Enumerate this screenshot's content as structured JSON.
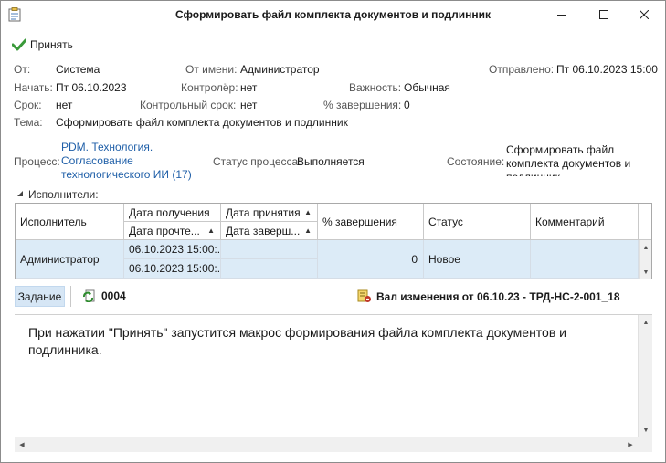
{
  "window": {
    "title": "Сформировать файл комплекта документов и подлинник"
  },
  "toolbar": {
    "accept_label": "Принять"
  },
  "header": {
    "from_label": "От:",
    "from_value": "Система",
    "on_behalf_label": "От имени:",
    "on_behalf_value": "Администратор",
    "sent_label": "Отправлено:",
    "sent_value": "Пт 06.10.2023 15:00",
    "start_label": "Начать:",
    "start_value": "Пт 06.10.2023",
    "controller_label": "Контролёр:",
    "controller_value": "нет",
    "importance_label": "Важность:",
    "importance_value": "Обычная",
    "deadline_label": "Срок:",
    "deadline_value": "нет",
    "control_deadline_label": "Контрольный срок:",
    "control_deadline_value": "нет",
    "completion_label": "% завершения:",
    "completion_value": "0",
    "subject_label": "Тема:",
    "subject_value": "Сформировать файл комплекта документов и подлинник"
  },
  "process": {
    "label": "Процесс:",
    "link_line1": "PDM. Технология.",
    "link_line2": "Согласование",
    "link_line3": "технологического ИИ (17)",
    "status_label": "Статус процесса:",
    "status_value": "Выполняется",
    "state_label": "Состояние:",
    "state_value": "Сформировать файл комплекта документов и подлинник"
  },
  "executors": {
    "section_label": "Исполнители:",
    "columns": {
      "executor": "Исполнитель",
      "received": "Дата получения",
      "accepted": "Дата принятия",
      "read": "Дата прочте...",
      "finished": "Дата заверш...",
      "completion": "% завершения",
      "status": "Статус",
      "comment": "Комментарий"
    },
    "rows": [
      {
        "executor": "Администратор",
        "received": "06.10.2023 15:00:...",
        "read": "06.10.2023 15:00:...",
        "accepted": "",
        "finished": "",
        "completion": "0",
        "status": "Новое",
        "comment": ""
      }
    ]
  },
  "lower_toolbar": {
    "task_tab": "Задание",
    "doc_number": "0004",
    "doc_ref": "Вал изменения от 06.10.23 - ТРД-НС-2-001_18"
  },
  "task_text": "При нажатии \"Принять\" запустится макрос формирования файла комплекта документов и подлинника.",
  "colors": {
    "accent": "#1f5fa8",
    "selected_row": "#dcebf7",
    "check_green": "#3a9a3a"
  }
}
